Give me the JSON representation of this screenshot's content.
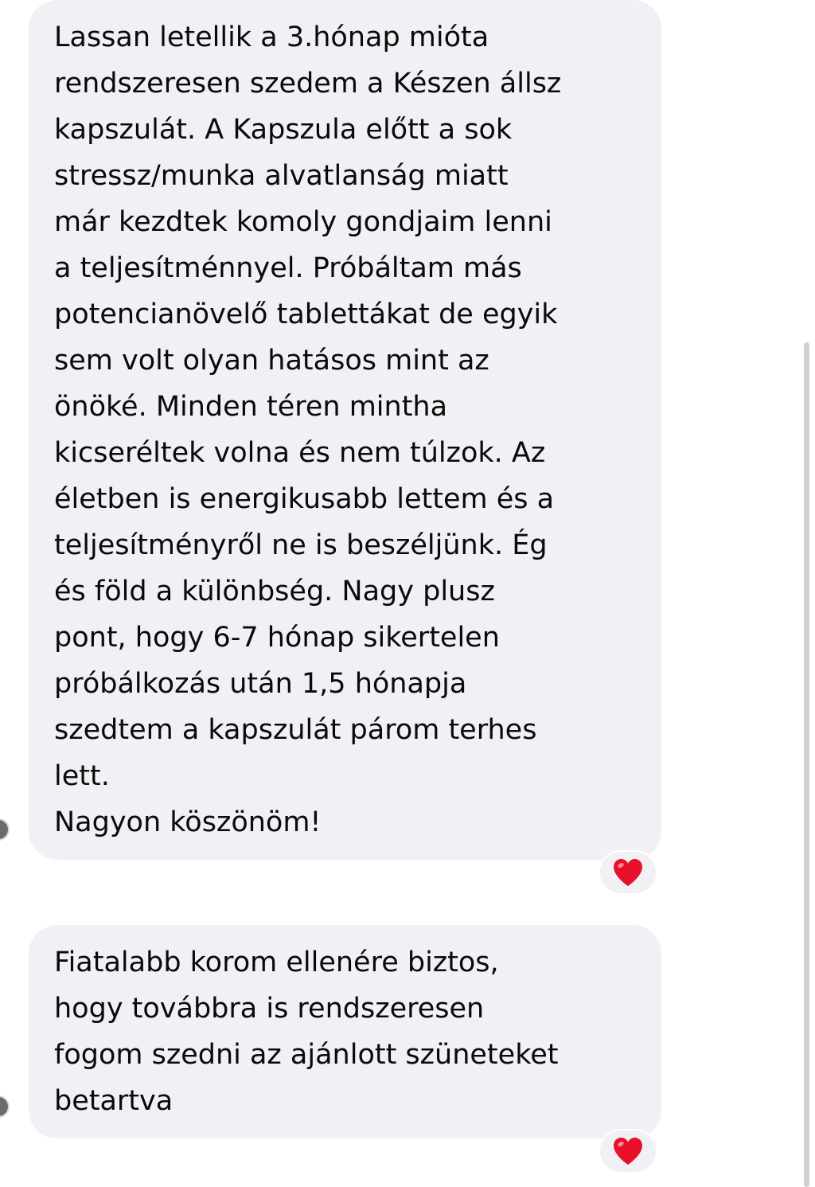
{
  "messages": [
    {
      "text": "Lassan letellik a 3.hónap mióta\nrendszeresen szedem a Készen állsz\nkapszulát. A Kapszula előtt a sok\nstressz/munka alvatlanság miatt\nmár kezdtek komoly gondjaim lenni\na teljesítménnyel. Próbáltam más\npotencianövelő tablettákat de egyik\nsem volt olyan hatásos mint az\nönöké. Minden téren mintha\nkicseréltek volna és nem túlzok. Az\néletben is energikusabb lettem és a\nteljesítményről ne is beszéljünk. Ég\nés föld a különbség. Nagy plusz\npont, hogy 6-7 hónap sikertelen\npróbálkozás után 1,5 hónapja\nszedtem a kapszulát párom terhes\nlett.\nNagyon köszönöm!",
      "reaction": "heart-emoji"
    },
    {
      "text": "Fiatalabb korom ellenére biztos,\nhogy továbbra is rendszeresen\nfogom szedni az ajánlott szüneteket\nbetartva",
      "reaction": "heart-emoji"
    }
  ],
  "colors": {
    "bubble_bg": "#f0f0f5",
    "text": "#0a0a0a",
    "heart": "#e8102a"
  }
}
